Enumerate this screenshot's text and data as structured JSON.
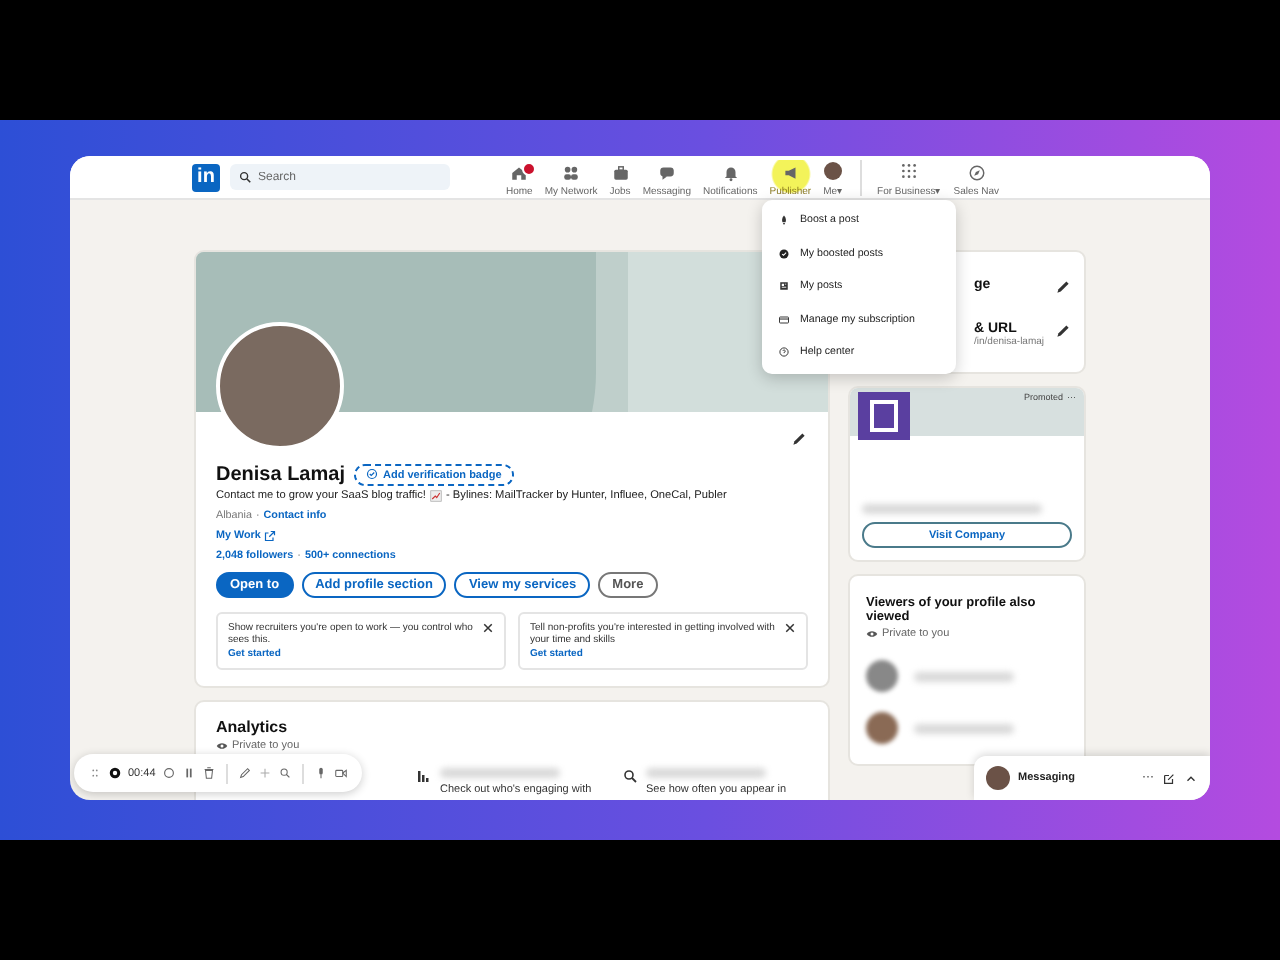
{
  "nav": {
    "logo": "in",
    "search": {
      "placeholder": "Search"
    },
    "items": [
      {
        "label": "Home",
        "selected": false,
        "badge": true
      },
      {
        "label": "My Network",
        "selected": false
      },
      {
        "label": "Jobs",
        "selected": false
      },
      {
        "label": "Messaging",
        "selected": false
      },
      {
        "label": "Notifications",
        "selected": false
      },
      {
        "label": "Publisher",
        "selected": true
      },
      {
        "label": "Me",
        "selected": false,
        "caret": "▾"
      }
    ],
    "extras": [
      {
        "label": "For Business",
        "caret": "▾"
      },
      {
        "label": "Sales Nav"
      }
    ]
  },
  "dropdown": [
    {
      "label": "Boost a post"
    },
    {
      "label": "My boosted posts"
    },
    {
      "label": "My posts"
    },
    {
      "label": "Manage my subscription"
    },
    {
      "label": "Help center"
    }
  ],
  "profile": {
    "name": "Denisa Lamaj",
    "verify": "Add verification badge",
    "headline_start": "Contact me to grow your SaaS blog traffic!",
    "headline_end": "- Bylines: MailTracker by Hunter, Influee, OneCal, Publer",
    "location": "Albania",
    "location_sep": "·",
    "contact": "Contact info",
    "work": "My Work",
    "followers": "2,048 followers",
    "stats_sep": "·",
    "connections": "500+ connections",
    "buttons": [
      {
        "label": "Open to",
        "kind": "primary"
      },
      {
        "label": "Add profile section",
        "kind": "outline"
      },
      {
        "label": "View my services",
        "kind": "outline"
      },
      {
        "label": "More",
        "kind": "neutral"
      }
    ],
    "suggestions": [
      {
        "text": "Show recruiters you're open to work — you control who sees this.",
        "link": "Get started"
      },
      {
        "text": "Tell non-profits you're interested in getting involved with your time and skills",
        "link": "Get started"
      }
    ]
  },
  "analytics": {
    "title": "Analytics",
    "privacy": "Private to you",
    "items": [
      {
        "text": "Check out who's engaging with"
      },
      {
        "text": "See how often you appear in"
      }
    ]
  },
  "side": {
    "settings": [
      {
        "title": "ge"
      },
      {
        "title": "& URL",
        "sub": "/in/denisa-lamaj"
      }
    ],
    "ad": {
      "label": "Promoted",
      "more": "···",
      "button": "Visit Company"
    },
    "viewers": {
      "title": "Viewers of your profile also viewed",
      "privacy": "Private to you"
    }
  },
  "recorder": {
    "time": "00:44"
  },
  "messaging": {
    "label": "Messaging",
    "more": "···"
  }
}
